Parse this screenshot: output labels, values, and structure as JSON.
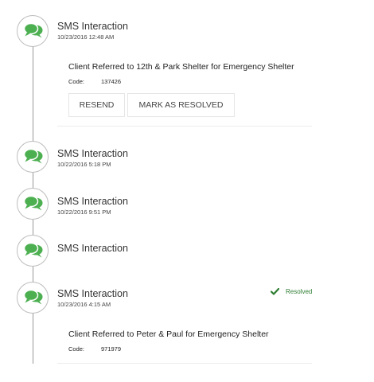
{
  "colors": {
    "accent_green": "#4caf50",
    "resolved_green": "#2e7d32",
    "timeline_line": "#9a9a9a"
  },
  "icons": {
    "interaction": "chat-bubbles-icon",
    "resolved": "check-icon"
  },
  "interactions": [
    {
      "title": "SMS Interaction",
      "timestamp": "10/23/2016 12:48 AM",
      "referral": "Client Referred to 12th & Park Shelter for Emergency Shelter",
      "code_label": "Code:",
      "code_value": "137426",
      "actions": {
        "resend_label": "RESEND",
        "resolve_label": "MARK AS RESOLVED"
      }
    },
    {
      "title": "SMS Interaction",
      "timestamp": "10/22/2016 5:18 PM"
    },
    {
      "title": "SMS Interaction",
      "timestamp": "10/22/2016 9:51 PM"
    },
    {
      "title": "SMS Interaction"
    },
    {
      "title": "SMS Interaction",
      "timestamp": "10/23/2016 4:15 AM",
      "status": "Resolved",
      "referral": "Client Referred to Peter & Paul for Emergency Shelter",
      "code_label": "Code:",
      "code_value": "971979"
    }
  ]
}
